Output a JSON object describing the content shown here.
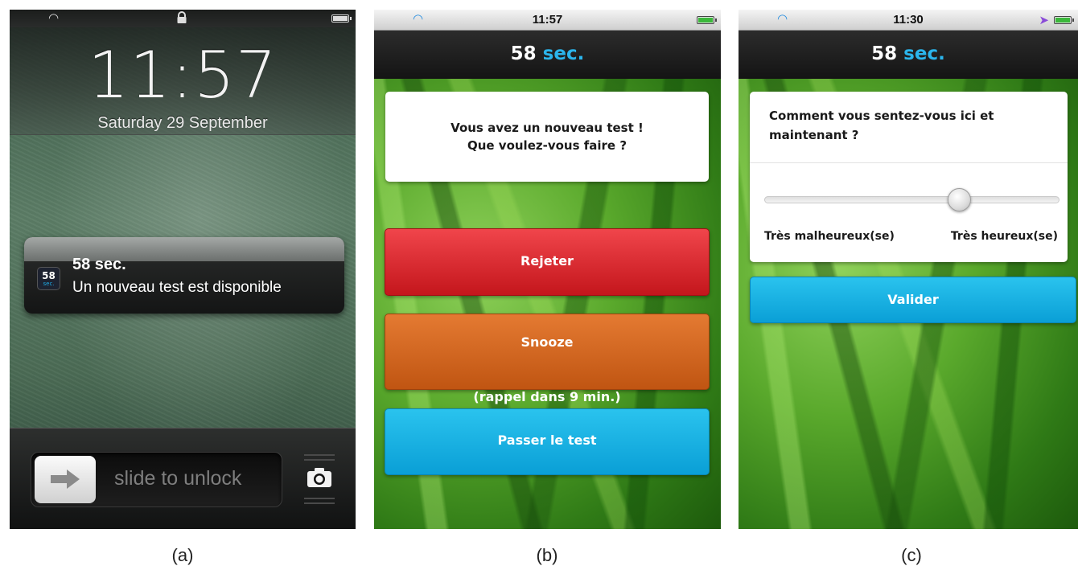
{
  "panels": {
    "a": {
      "caption": "(a)",
      "status_bar": {
        "icons": [
          "wifi-icon",
          "lock-icon",
          "battery-icon"
        ]
      },
      "lock_screen": {
        "time": "11:57",
        "date": "Saturday 29 September"
      },
      "notification": {
        "app_icon": {
          "number": "58",
          "unit": "sec."
        },
        "title": "58 sec.",
        "message": "Un nouveau test est disponible"
      },
      "unlock": {
        "label": "slide to unlock",
        "knob_icon": "arrow-right-icon",
        "camera_icon": "camera-icon"
      }
    },
    "b": {
      "caption": "(b)",
      "status_bar": {
        "time": "11:57",
        "icons": [
          "wifi-icon",
          "battery-icon"
        ]
      },
      "header": {
        "number": "58",
        "unit": "sec."
      },
      "prompt": {
        "line1": "Vous avez un nouveau test !",
        "line2": "Que voulez-vous faire ?"
      },
      "buttons": {
        "reject": "Rejeter",
        "snooze_line1": "Snooze",
        "snooze_line2": "(rappel dans 9 min.)",
        "take_test": "Passer le test"
      }
    },
    "c": {
      "caption": "(c)",
      "status_bar": {
        "time": "11:30",
        "icons": [
          "wifi-icon",
          "location-icon",
          "battery-icon"
        ]
      },
      "header": {
        "number": "58",
        "unit": "sec."
      },
      "question": "Comment vous sentez-vous ici et maintenant ?",
      "slider": {
        "value": 0.66,
        "min_label": "Très malheureux(se)",
        "max_label": "Très heureux(se)"
      },
      "submit": "Valider"
    }
  },
  "colors": {
    "accent_blue": "#0a9fd6",
    "reject_red": "#c4161c",
    "snooze_orange": "#c05512",
    "header_dark": "#141414"
  }
}
